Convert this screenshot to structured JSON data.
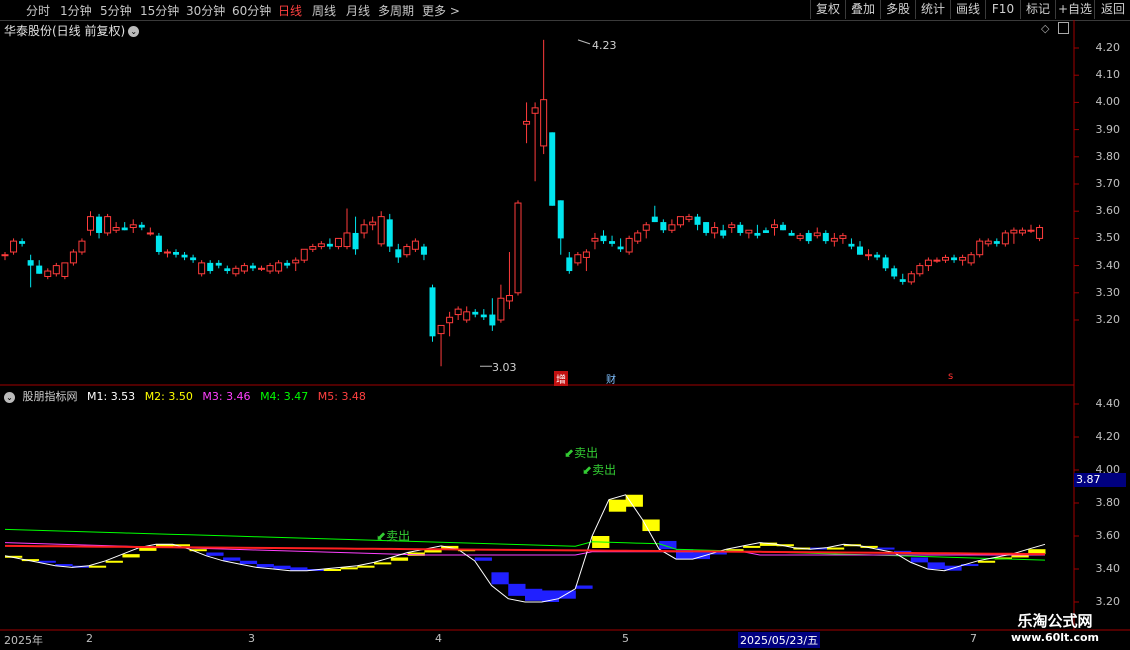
{
  "toolbar": {
    "timeframes": [
      "分时",
      "1分钟",
      "5分钟",
      "15分钟",
      "30分钟",
      "60分钟",
      "日线",
      "周线",
      "月线",
      "多周期",
      "更多 >"
    ],
    "active": "日线",
    "right_buttons": [
      "复权",
      "叠加",
      "多股",
      "统计",
      "画线",
      "F10",
      "标记",
      "+自选",
      "返回"
    ]
  },
  "title": "华泰股份(日线 前复权)",
  "price_axis": [
    "4.20",
    "4.10",
    "4.00",
    "3.90",
    "3.80",
    "3.70",
    "3.60",
    "3.50",
    "3.40",
    "3.30",
    "3.20"
  ],
  "annotations": {
    "high": "4.23",
    "low": "3.03"
  },
  "event_tags": {
    "a": "增",
    "b": "财",
    "c": "s"
  },
  "indicator": {
    "name": "股朋指标网",
    "m1": "M1: 3.53",
    "m2": "M2: 3.50",
    "m3": "M3: 3.46",
    "m4": "M4: 3.47",
    "m5": "M5: 3.48",
    "axis": [
      "4.40",
      "4.20",
      "4.00",
      "3.80",
      "3.60",
      "3.40",
      "3.20"
    ],
    "current": "3.87",
    "signals": [
      "卖出",
      "卖出",
      "卖出"
    ]
  },
  "dates": [
    "2025年",
    "2",
    "3",
    "4",
    "5",
    "2025/05/23/五",
    "7"
  ],
  "watermark": {
    "name": "乐淘公式网",
    "url": "www.60lt.com"
  },
  "colors": {
    "up": "#ff3c3c",
    "down": "#00e5ee",
    "panel_border": "#a00000",
    "m1": "#ffffff",
    "m2": "#ffff00",
    "m3": "#ff40ff",
    "m4": "#00ff00",
    "m5": "#ff2020"
  },
  "chart_data": {
    "type": "candlestick",
    "candles": [
      [
        3.44,
        3.45,
        3.42,
        3.44
      ],
      [
        3.45,
        3.5,
        3.44,
        3.49
      ],
      [
        3.49,
        3.5,
        3.47,
        3.48
      ],
      [
        3.42,
        3.44,
        3.32,
        3.4
      ],
      [
        3.4,
        3.42,
        3.37,
        3.37
      ],
      [
        3.36,
        3.39,
        3.35,
        3.38
      ],
      [
        3.37,
        3.41,
        3.36,
        3.4
      ],
      [
        3.36,
        3.41,
        3.35,
        3.41
      ],
      [
        3.41,
        3.46,
        3.4,
        3.45
      ],
      [
        3.45,
        3.5,
        3.44,
        3.49
      ],
      [
        3.53,
        3.6,
        3.51,
        3.58
      ],
      [
        3.58,
        3.59,
        3.5,
        3.52
      ],
      [
        3.52,
        3.59,
        3.51,
        3.58
      ],
      [
        3.53,
        3.56,
        3.52,
        3.54
      ],
      [
        3.54,
        3.56,
        3.53,
        3.53
      ],
      [
        3.54,
        3.57,
        3.52,
        3.55
      ],
      [
        3.55,
        3.56,
        3.53,
        3.54
      ],
      [
        3.52,
        3.54,
        3.51,
        3.52
      ],
      [
        3.51,
        3.52,
        3.44,
        3.45
      ],
      [
        3.45,
        3.46,
        3.43,
        3.45
      ],
      [
        3.45,
        3.46,
        3.43,
        3.44
      ],
      [
        3.44,
        3.45,
        3.42,
        3.43
      ],
      [
        3.43,
        3.44,
        3.41,
        3.42
      ],
      [
        3.37,
        3.42,
        3.36,
        3.41
      ],
      [
        3.41,
        3.42,
        3.37,
        3.38
      ],
      [
        3.41,
        3.42,
        3.39,
        3.4
      ],
      [
        3.39,
        3.4,
        3.37,
        3.38
      ],
      [
        3.37,
        3.4,
        3.36,
        3.39
      ],
      [
        3.38,
        3.41,
        3.37,
        3.4
      ],
      [
        3.4,
        3.41,
        3.38,
        3.39
      ],
      [
        3.39,
        3.4,
        3.38,
        3.39
      ],
      [
        3.38,
        3.41,
        3.37,
        3.4
      ],
      [
        3.38,
        3.42,
        3.37,
        3.41
      ],
      [
        3.41,
        3.42,
        3.39,
        3.4
      ],
      [
        3.41,
        3.43,
        3.38,
        3.42
      ],
      [
        3.42,
        3.46,
        3.41,
        3.46
      ],
      [
        3.46,
        3.48,
        3.45,
        3.47
      ],
      [
        3.47,
        3.49,
        3.46,
        3.48
      ],
      [
        3.48,
        3.5,
        3.46,
        3.47
      ],
      [
        3.47,
        3.5,
        3.46,
        3.5
      ],
      [
        3.47,
        3.61,
        3.46,
        3.52
      ],
      [
        3.52,
        3.58,
        3.44,
        3.46
      ],
      [
        3.52,
        3.57,
        3.5,
        3.55
      ],
      [
        3.55,
        3.58,
        3.53,
        3.56
      ],
      [
        3.48,
        3.6,
        3.47,
        3.58
      ],
      [
        3.57,
        3.59,
        3.45,
        3.47
      ],
      [
        3.46,
        3.48,
        3.41,
        3.43
      ],
      [
        3.44,
        3.48,
        3.43,
        3.47
      ],
      [
        3.46,
        3.5,
        3.45,
        3.49
      ],
      [
        3.47,
        3.48,
        3.42,
        3.44
      ],
      [
        3.32,
        3.33,
        3.12,
        3.14
      ],
      [
        3.15,
        3.17,
        3.03,
        3.18
      ],
      [
        3.19,
        3.23,
        3.14,
        3.21
      ],
      [
        3.22,
        3.25,
        3.2,
        3.24
      ],
      [
        3.2,
        3.25,
        3.19,
        3.23
      ],
      [
        3.23,
        3.24,
        3.21,
        3.22
      ],
      [
        3.22,
        3.24,
        3.2,
        3.21
      ],
      [
        3.22,
        3.28,
        3.16,
        3.18
      ],
      [
        3.2,
        3.33,
        3.19,
        3.28
      ],
      [
        3.27,
        3.45,
        3.24,
        3.29
      ],
      [
        3.3,
        3.64,
        3.29,
        3.63
      ],
      [
        3.92,
        4.0,
        3.85,
        3.93
      ],
      [
        3.96,
        4.0,
        3.71,
        3.98
      ],
      [
        3.84,
        4.23,
        3.81,
        4.01
      ],
      [
        3.89,
        3.89,
        3.62,
        3.62
      ],
      [
        3.64,
        3.64,
        3.44,
        3.5
      ],
      [
        3.43,
        3.45,
        3.37,
        3.38
      ],
      [
        3.41,
        3.45,
        3.4,
        3.44
      ],
      [
        3.43,
        3.46,
        3.38,
        3.45
      ],
      [
        3.49,
        3.52,
        3.46,
        3.5
      ],
      [
        3.51,
        3.53,
        3.48,
        3.49
      ],
      [
        3.49,
        3.51,
        3.47,
        3.48
      ],
      [
        3.47,
        3.5,
        3.45,
        3.46
      ],
      [
        3.45,
        3.51,
        3.44,
        3.5
      ],
      [
        3.49,
        3.53,
        3.48,
        3.52
      ],
      [
        3.53,
        3.56,
        3.5,
        3.55
      ],
      [
        3.58,
        3.62,
        3.56,
        3.56
      ],
      [
        3.56,
        3.57,
        3.52,
        3.53
      ],
      [
        3.53,
        3.57,
        3.52,
        3.55
      ],
      [
        3.55,
        3.58,
        3.54,
        3.58
      ],
      [
        3.57,
        3.59,
        3.56,
        3.58
      ],
      [
        3.58,
        3.59,
        3.53,
        3.55
      ],
      [
        3.56,
        3.56,
        3.51,
        3.52
      ],
      [
        3.52,
        3.56,
        3.5,
        3.54
      ],
      [
        3.53,
        3.55,
        3.5,
        3.51
      ],
      [
        3.54,
        3.56,
        3.52,
        3.55
      ],
      [
        3.55,
        3.56,
        3.51,
        3.52
      ],
      [
        3.52,
        3.53,
        3.5,
        3.53
      ],
      [
        3.52,
        3.55,
        3.5,
        3.51
      ],
      [
        3.53,
        3.54,
        3.52,
        3.52
      ],
      [
        3.54,
        3.57,
        3.51,
        3.55
      ],
      [
        3.55,
        3.56,
        3.53,
        3.53
      ],
      [
        3.52,
        3.53,
        3.51,
        3.51
      ],
      [
        3.5,
        3.52,
        3.49,
        3.51
      ],
      [
        3.52,
        3.53,
        3.48,
        3.49
      ],
      [
        3.51,
        3.54,
        3.5,
        3.52
      ],
      [
        3.52,
        3.53,
        3.48,
        3.49
      ],
      [
        3.49,
        3.52,
        3.47,
        3.5
      ],
      [
        3.5,
        3.52,
        3.48,
        3.51
      ],
      [
        3.48,
        3.5,
        3.46,
        3.47
      ],
      [
        3.47,
        3.49,
        3.44,
        3.44
      ],
      [
        3.44,
        3.46,
        3.42,
        3.44
      ],
      [
        3.44,
        3.45,
        3.42,
        3.43
      ],
      [
        3.43,
        3.44,
        3.38,
        3.39
      ],
      [
        3.39,
        3.4,
        3.35,
        3.36
      ],
      [
        3.35,
        3.37,
        3.33,
        3.34
      ],
      [
        3.34,
        3.38,
        3.33,
        3.37
      ],
      [
        3.37,
        3.41,
        3.36,
        3.4
      ],
      [
        3.4,
        3.43,
        3.38,
        3.42
      ],
      [
        3.42,
        3.43,
        3.41,
        3.42
      ],
      [
        3.42,
        3.44,
        3.41,
        3.43
      ],
      [
        3.43,
        3.44,
        3.41,
        3.42
      ],
      [
        3.42,
        3.44,
        3.4,
        3.43
      ],
      [
        3.41,
        3.45,
        3.4,
        3.44
      ],
      [
        3.44,
        3.5,
        3.43,
        3.49
      ],
      [
        3.48,
        3.5,
        3.47,
        3.49
      ],
      [
        3.49,
        3.5,
        3.47,
        3.48
      ],
      [
        3.48,
        3.53,
        3.47,
        3.52
      ],
      [
        3.52,
        3.54,
        3.48,
        3.53
      ],
      [
        3.52,
        3.54,
        3.51,
        3.53
      ],
      [
        3.53,
        3.55,
        3.52,
        3.53
      ],
      [
        3.5,
        3.55,
        3.49,
        3.54
      ]
    ],
    "indicator_series": {
      "white": [
        3.48,
        3.46,
        3.44,
        3.42,
        3.41,
        3.42,
        3.45,
        3.49,
        3.53,
        3.55,
        3.55,
        3.52,
        3.48,
        3.45,
        3.43,
        3.41,
        3.4,
        3.39,
        3.39,
        3.4,
        3.41,
        3.42,
        3.44,
        3.47,
        3.5,
        3.52,
        3.54,
        3.52,
        3.45,
        3.3,
        3.22,
        3.2,
        3.2,
        3.22,
        3.28,
        3.6,
        3.82,
        3.85,
        3.7,
        3.52,
        3.46,
        3.46,
        3.49,
        3.52,
        3.54,
        3.56,
        3.55,
        3.53,
        3.52,
        3.53,
        3.55,
        3.54,
        3.52,
        3.5,
        3.44,
        3.4,
        3.39,
        3.42,
        3.45,
        3.47,
        3.49,
        3.52,
        3.55
      ],
      "yellow": [
        3.47,
        3.46,
        3.45,
        3.43,
        3.42,
        3.42,
        3.44,
        3.47,
        3.51,
        3.53,
        3.54,
        3.52,
        3.5,
        3.47,
        3.45,
        3.43,
        3.42,
        3.41,
        3.4,
        3.4,
        3.41,
        3.42,
        3.43,
        3.45,
        3.48,
        3.5,
        3.52,
        3.51,
        3.47,
        3.38,
        3.31,
        3.28,
        3.27,
        3.27,
        3.3,
        3.48,
        3.62,
        3.66,
        3.63,
        3.57,
        3.52,
        3.5,
        3.5,
        3.51,
        3.53,
        3.54,
        3.54,
        3.53,
        3.53,
        3.53,
        3.54,
        3.54,
        3.53,
        3.51,
        3.47,
        3.44,
        3.42,
        3.43,
        3.44,
        3.46,
        3.47,
        3.49,
        3.51
      ]
    }
  }
}
